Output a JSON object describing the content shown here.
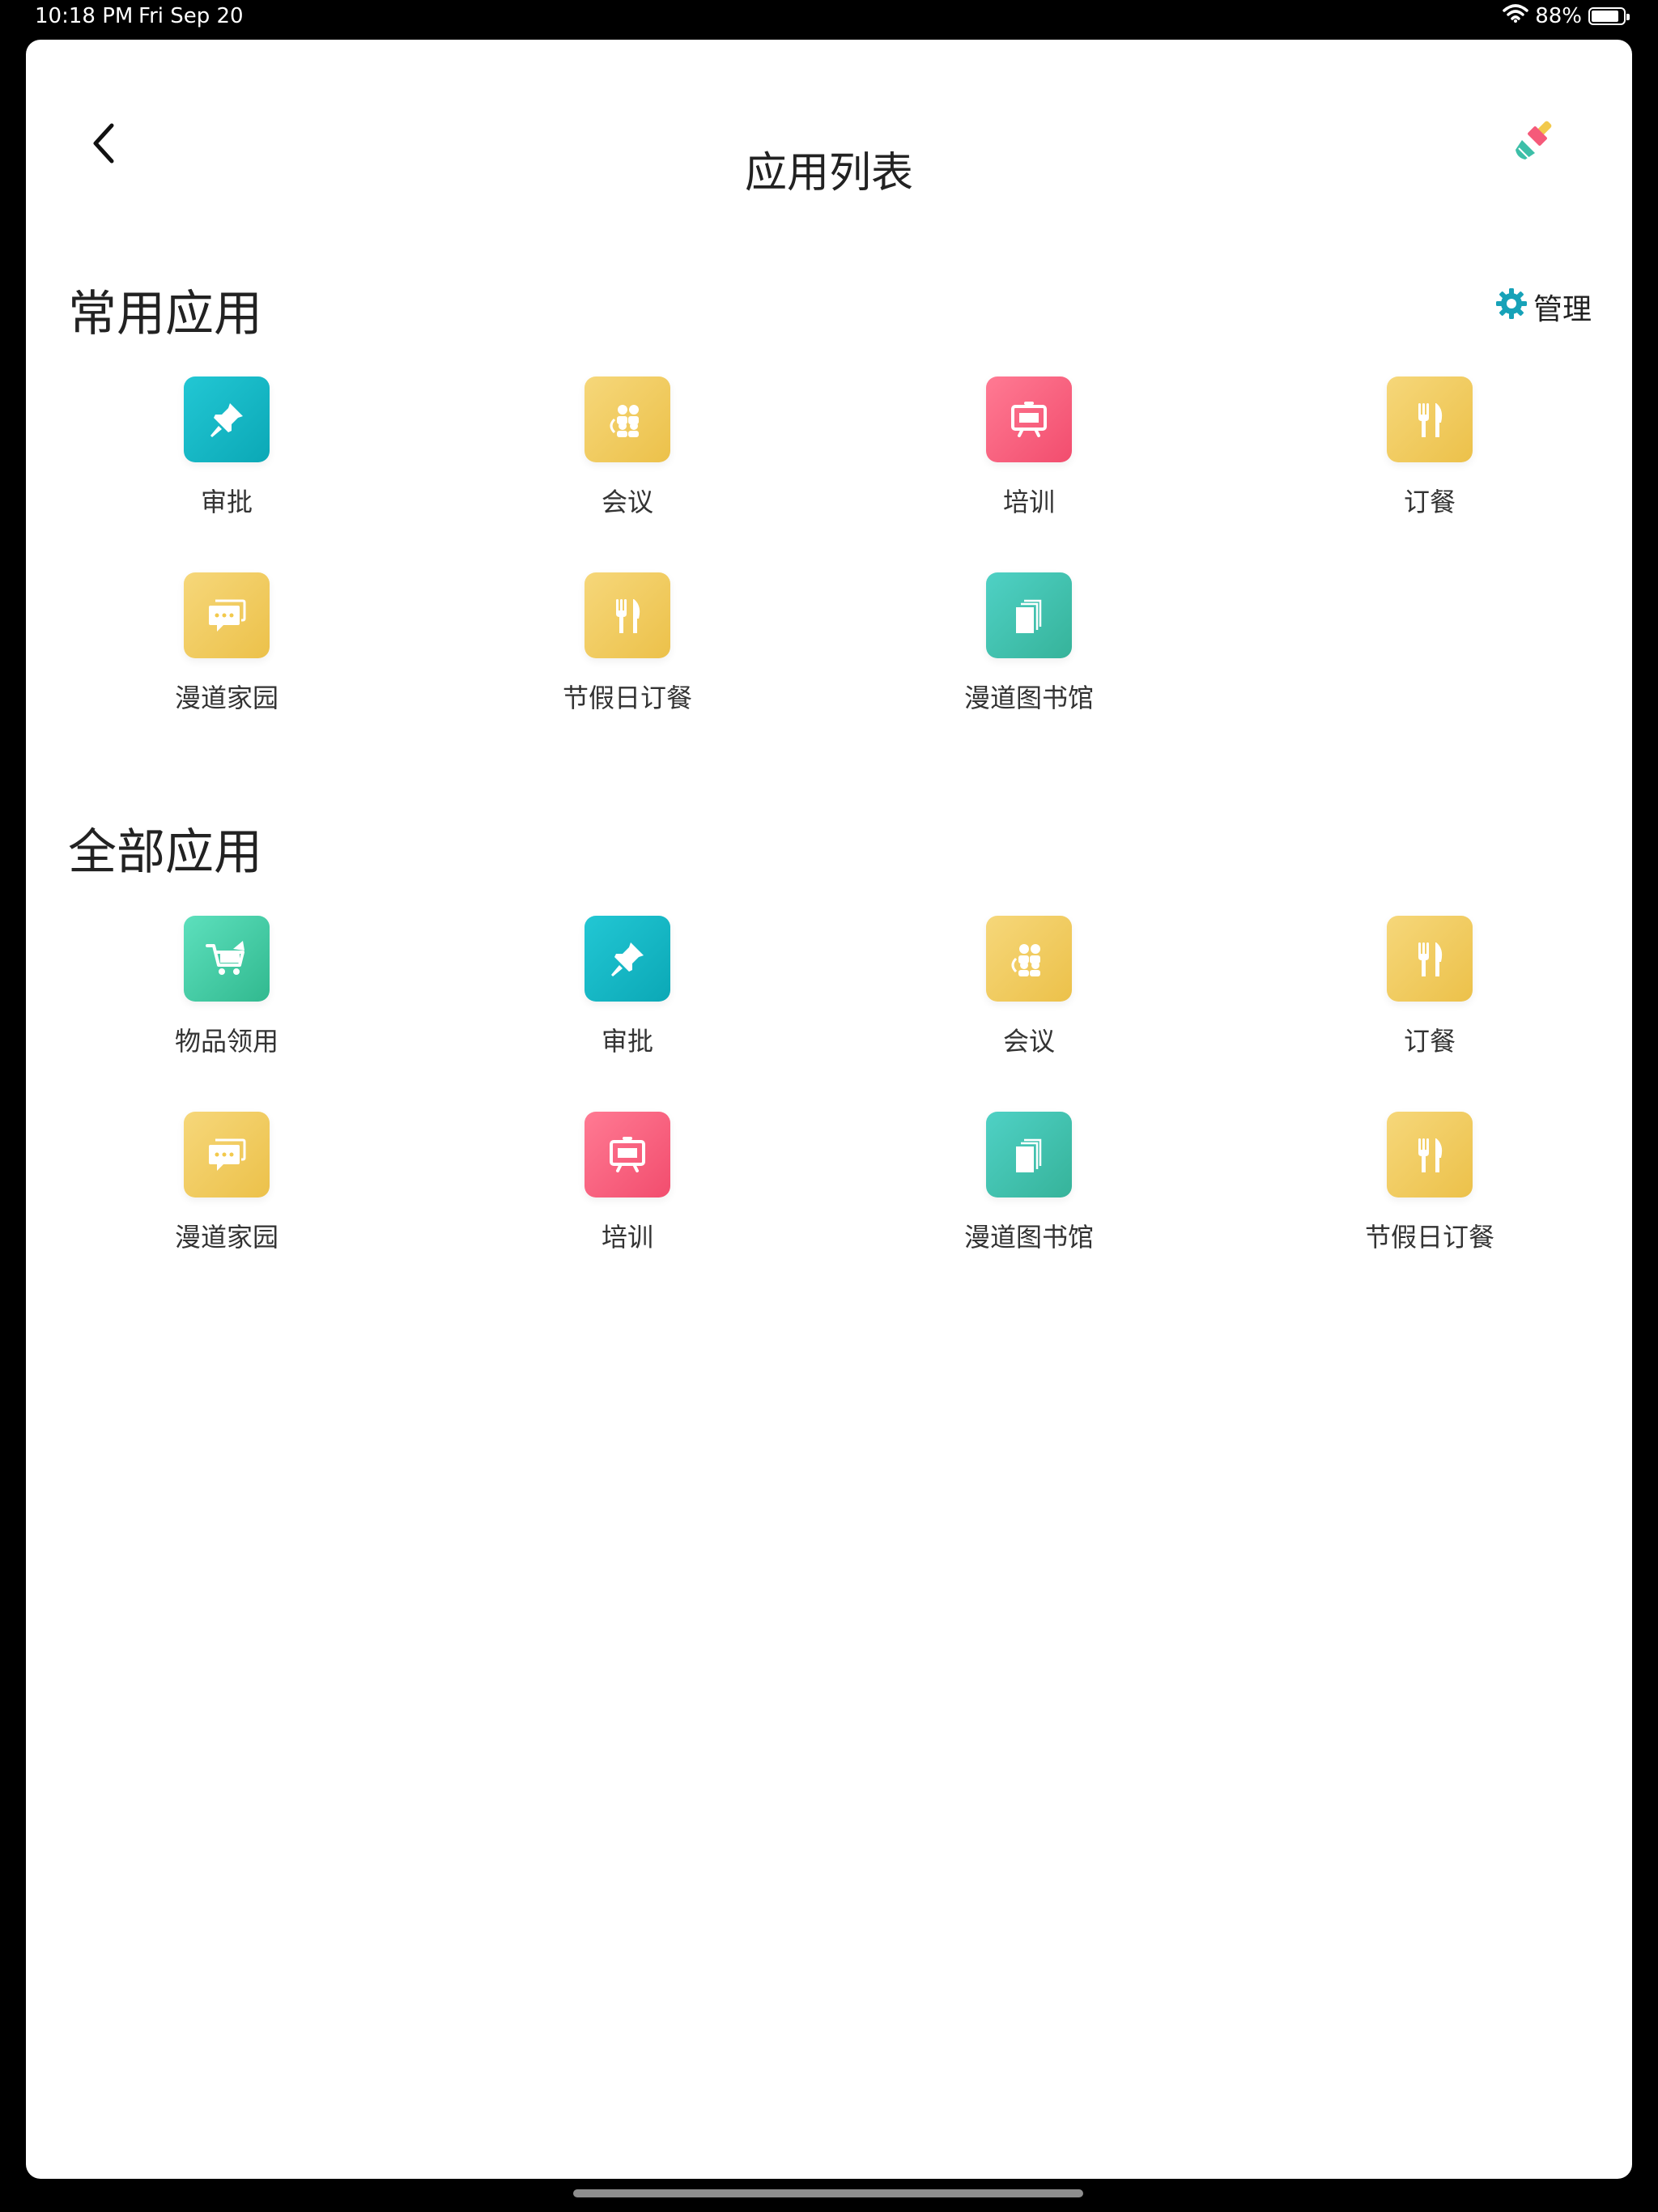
{
  "status_bar": {
    "time": "10:18 PM",
    "date": "Fri Sep 20",
    "battery": "88%",
    "battery_level": 0.88
  },
  "header": {
    "title": "应用列表",
    "back_icon": "chevron-left-icon",
    "action_icon": "brush-icon"
  },
  "common": {
    "title": "常用应用",
    "manage_label": "管理",
    "manage_icon": "gear-icon",
    "apps": [
      {
        "label": "审批",
        "icon": "pin-icon",
        "color": "teal"
      },
      {
        "label": "会议",
        "icon": "meeting-icon",
        "color": "yellow"
      },
      {
        "label": "培训",
        "icon": "easel-icon",
        "color": "pink"
      },
      {
        "label": "订餐",
        "icon": "utensils-icon",
        "color": "yellow"
      },
      {
        "label": "漫道家园",
        "icon": "chat-icon",
        "color": "yellow"
      },
      {
        "label": "节假日订餐",
        "icon": "utensils-icon",
        "color": "yellow"
      },
      {
        "label": "漫道图书馆",
        "icon": "book-icon",
        "color": "green"
      }
    ]
  },
  "all": {
    "title": "全部应用",
    "apps": [
      {
        "label": "物品领用",
        "icon": "cart-icon",
        "color": "mint"
      },
      {
        "label": "审批",
        "icon": "pin-icon",
        "color": "teal"
      },
      {
        "label": "会议",
        "icon": "meeting-icon",
        "color": "yellow"
      },
      {
        "label": "订餐",
        "icon": "utensils-icon",
        "color": "yellow"
      },
      {
        "label": "漫道家园",
        "icon": "chat-icon",
        "color": "yellow"
      },
      {
        "label": "培训",
        "icon": "easel-icon",
        "color": "pink"
      },
      {
        "label": "漫道图书馆",
        "icon": "book-icon",
        "color": "green"
      },
      {
        "label": "节假日订餐",
        "icon": "utensils-icon",
        "color": "yellow"
      }
    ]
  },
  "colors": {
    "accent": "#17a2b8",
    "teal": "#12b8c4",
    "yellow": "#f2c94c",
    "pink": "#f55a7a",
    "green": "#3dbfa8",
    "mint": "#3ecfa6"
  }
}
